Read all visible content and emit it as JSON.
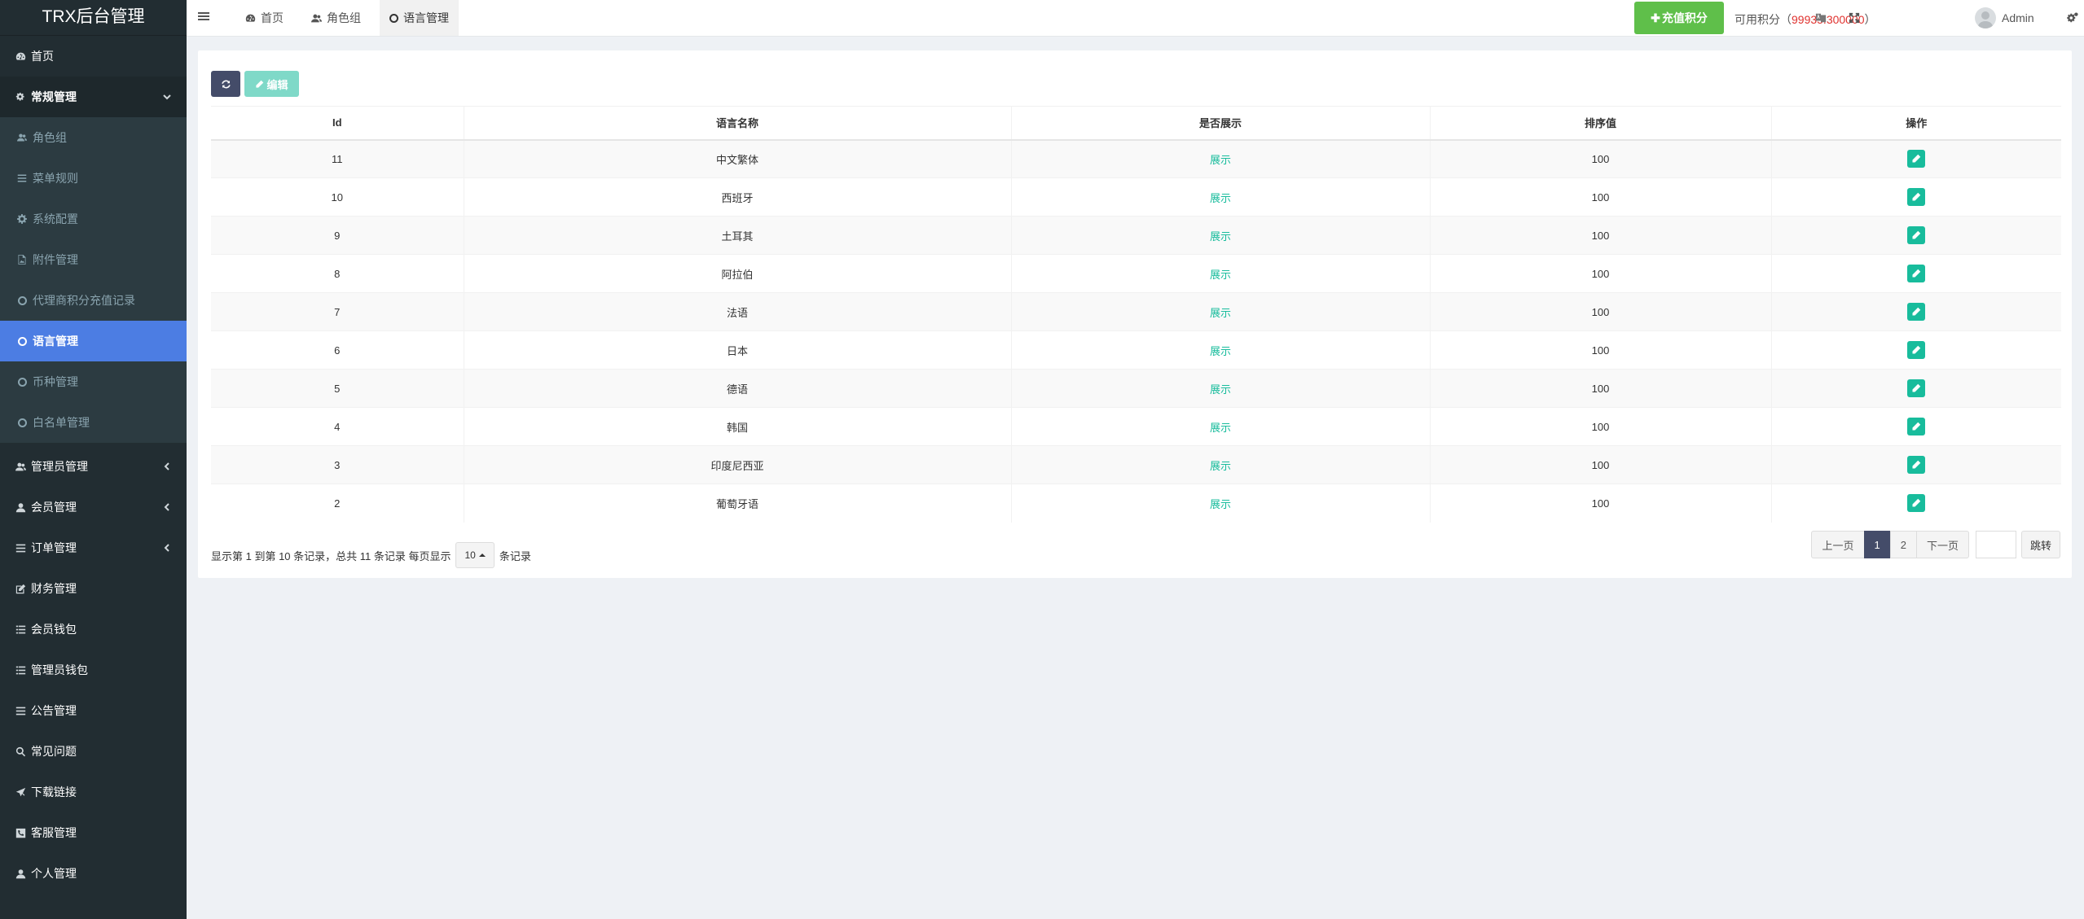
{
  "brand": "TRX后台管理",
  "sidebar": {
    "top": [
      {
        "label": "首页",
        "icon": "dashboard-icon"
      }
    ],
    "group": {
      "label": "常规管理",
      "icon": "cogs-icon"
    },
    "sub": [
      {
        "label": "角色组",
        "icon": "users-icon"
      },
      {
        "label": "菜单规则",
        "icon": "list-icon"
      },
      {
        "label": "系统配置",
        "icon": "gear-icon"
      },
      {
        "label": "附件管理",
        "icon": "file-image-icon"
      },
      {
        "label": "代理商积分充值记录",
        "icon": "circle-icon"
      },
      {
        "label": "语言管理",
        "icon": "circle-icon",
        "active": true
      },
      {
        "label": "币种管理",
        "icon": "circle-icon"
      },
      {
        "label": "白名单管理",
        "icon": "circle-icon"
      }
    ],
    "items": [
      {
        "label": "管理员管理",
        "icon": "users-icon",
        "chevron": true
      },
      {
        "label": "会员管理",
        "icon": "user-icon",
        "chevron": true
      },
      {
        "label": "订单管理",
        "icon": "list-icon",
        "chevron": true
      },
      {
        "label": "财务管理",
        "icon": "edit-icon"
      },
      {
        "label": "会员钱包",
        "icon": "list-icon"
      },
      {
        "label": "管理员钱包",
        "icon": "list-icon"
      },
      {
        "label": "公告管理",
        "icon": "list-icon"
      },
      {
        "label": "常见问题",
        "icon": "search-icon"
      },
      {
        "label": "下载链接",
        "icon": "plane-icon"
      },
      {
        "label": "客服管理",
        "icon": "phone-icon"
      },
      {
        "label": "个人管理",
        "icon": "user-icon"
      }
    ]
  },
  "header": {
    "tabs": [
      {
        "label": "首页",
        "icon": "dashboard-icon"
      },
      {
        "label": "角色组",
        "icon": "users-icon"
      },
      {
        "label": "语言管理",
        "icon": "circle-icon",
        "active": true
      }
    ],
    "recharge_label": "充值积分",
    "credit_label": "可用积分（",
    "credit_value": "99935.300000",
    "credit_suffix": "）",
    "admin_name": "Admin"
  },
  "toolbar": {
    "edit_label": "编辑"
  },
  "table": {
    "columns": [
      "Id",
      "语言名称",
      "是否展示",
      "排序值",
      "操作"
    ],
    "rows": [
      {
        "id": "11",
        "name": "中文繁体",
        "status": "展示",
        "sort": "100"
      },
      {
        "id": "10",
        "name": "西班牙",
        "status": "展示",
        "sort": "100"
      },
      {
        "id": "9",
        "name": "土耳其",
        "status": "展示",
        "sort": "100"
      },
      {
        "id": "8",
        "name": "阿拉伯",
        "status": "展示",
        "sort": "100"
      },
      {
        "id": "7",
        "name": "法语",
        "status": "展示",
        "sort": "100"
      },
      {
        "id": "6",
        "name": "日本",
        "status": "展示",
        "sort": "100"
      },
      {
        "id": "5",
        "name": "德语",
        "status": "展示",
        "sort": "100"
      },
      {
        "id": "4",
        "name": "韩国",
        "status": "展示",
        "sort": "100"
      },
      {
        "id": "3",
        "name": "印度尼西亚",
        "status": "展示",
        "sort": "100"
      },
      {
        "id": "2",
        "name": "葡萄牙语",
        "status": "展示",
        "sort": "100"
      }
    ]
  },
  "footer": {
    "summary": "显示第 1 到第 10 条记录，总共 11 条记录 每页显示",
    "page_size": "10",
    "suffix": "条记录"
  },
  "pager": {
    "prev": "上一页",
    "pages": [
      "1",
      "2"
    ],
    "current": "1",
    "next": "下一页",
    "jump": "跳转"
  },
  "colors": {
    "sidebar_bg": "#222d32",
    "active_menu": "#4c7de3",
    "recharge": "#5fbf4a",
    "status_green": "#18bc9c",
    "credit_red": "#e0322f",
    "primary_dark": "#444c69"
  }
}
